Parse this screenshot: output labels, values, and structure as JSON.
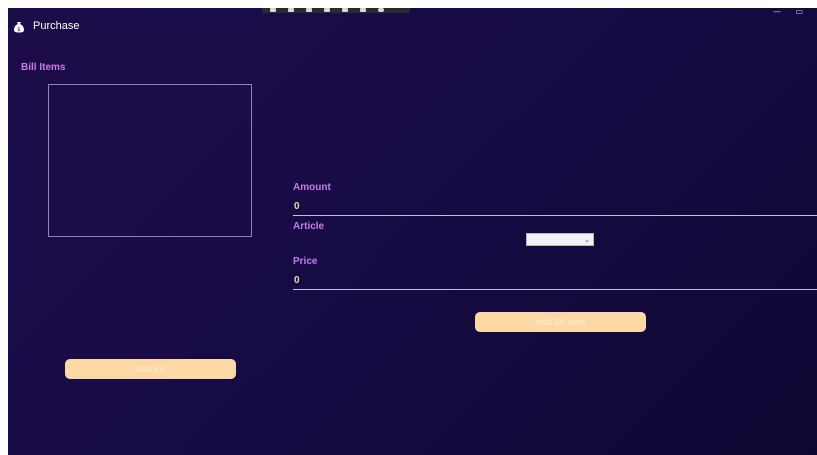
{
  "window": {
    "title": "Purchase",
    "controls": {
      "minimize": "—",
      "maximize": "▭"
    }
  },
  "bill_items": {
    "label": "Bill Items"
  },
  "form": {
    "amount": {
      "label": "Amount",
      "value": "0"
    },
    "article": {
      "label": "Article",
      "selected": ""
    },
    "price": {
      "label": "Price",
      "value": "0"
    }
  },
  "buttons": {
    "add_bill_item": "Add Bill Item",
    "add_bill": "Add Bill"
  },
  "colors": {
    "background": "#1c0c4a",
    "label": "#c97be8",
    "value": "#f1d9a8",
    "button": "#fcd8a4"
  },
  "icons": {
    "app": "money-bag-icon",
    "dropdown": "chevron-down-icon"
  }
}
